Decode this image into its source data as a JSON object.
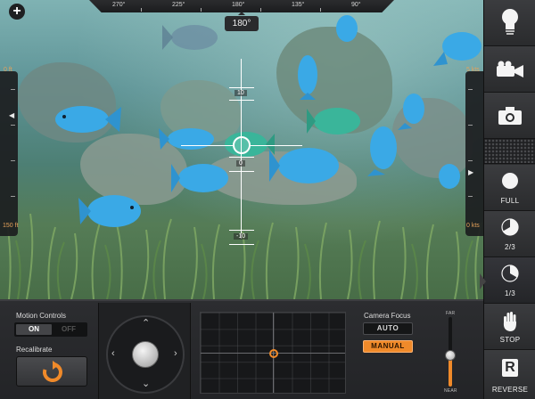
{
  "compass": {
    "labels": [
      "270°",
      "225°",
      "180°",
      "135°",
      "90°"
    ],
    "heading": "180°"
  },
  "depth_gauge": {
    "top_label": "0 ft",
    "bottom_label": "150 ft",
    "level": 0.24
  },
  "speed_gauge": {
    "top_label": "5 kts",
    "bottom_label": "0 kts",
    "level": 0.62
  },
  "crosshair": {
    "upper_value": "10",
    "center_value": "0",
    "lower_value": "-10"
  },
  "sidebar": {
    "buttons": [
      {
        "id": "light",
        "icon": "lightbulb-icon",
        "label": ""
      },
      {
        "id": "video",
        "icon": "video-camera-icon",
        "label": ""
      },
      {
        "id": "photo",
        "icon": "camera-icon",
        "label": ""
      },
      {
        "id": "full",
        "icon": "full-circle-icon",
        "label": "FULL"
      },
      {
        "id": "two-thirds",
        "icon": "two-thirds-pie-icon",
        "label": "2/3"
      },
      {
        "id": "one-third",
        "icon": "one-third-pie-icon",
        "label": "1/3",
        "selected": true
      },
      {
        "id": "stop",
        "icon": "hand-icon",
        "label": "STOP"
      },
      {
        "id": "reverse",
        "icon": "reverse-r-icon",
        "label": "REVERSE"
      }
    ],
    "reverse_letter": "R"
  },
  "panel": {
    "motion_controls": {
      "title": "Motion Controls",
      "on_label": "ON",
      "off_label": "OFF",
      "state": "on"
    },
    "recalibrate": {
      "title": "Recalibrate"
    },
    "camera_focus": {
      "title": "Camera Focus",
      "auto_label": "AUTO",
      "manual_label": "MANUAL",
      "selected": "manual"
    },
    "focus_slider": {
      "far_label": "FAR",
      "near_label": "NEAR",
      "level": 0.55
    }
  },
  "colors": {
    "accent": "#f08a2a",
    "panel": "#2a2b2d",
    "fish": "#3aa9e6"
  }
}
